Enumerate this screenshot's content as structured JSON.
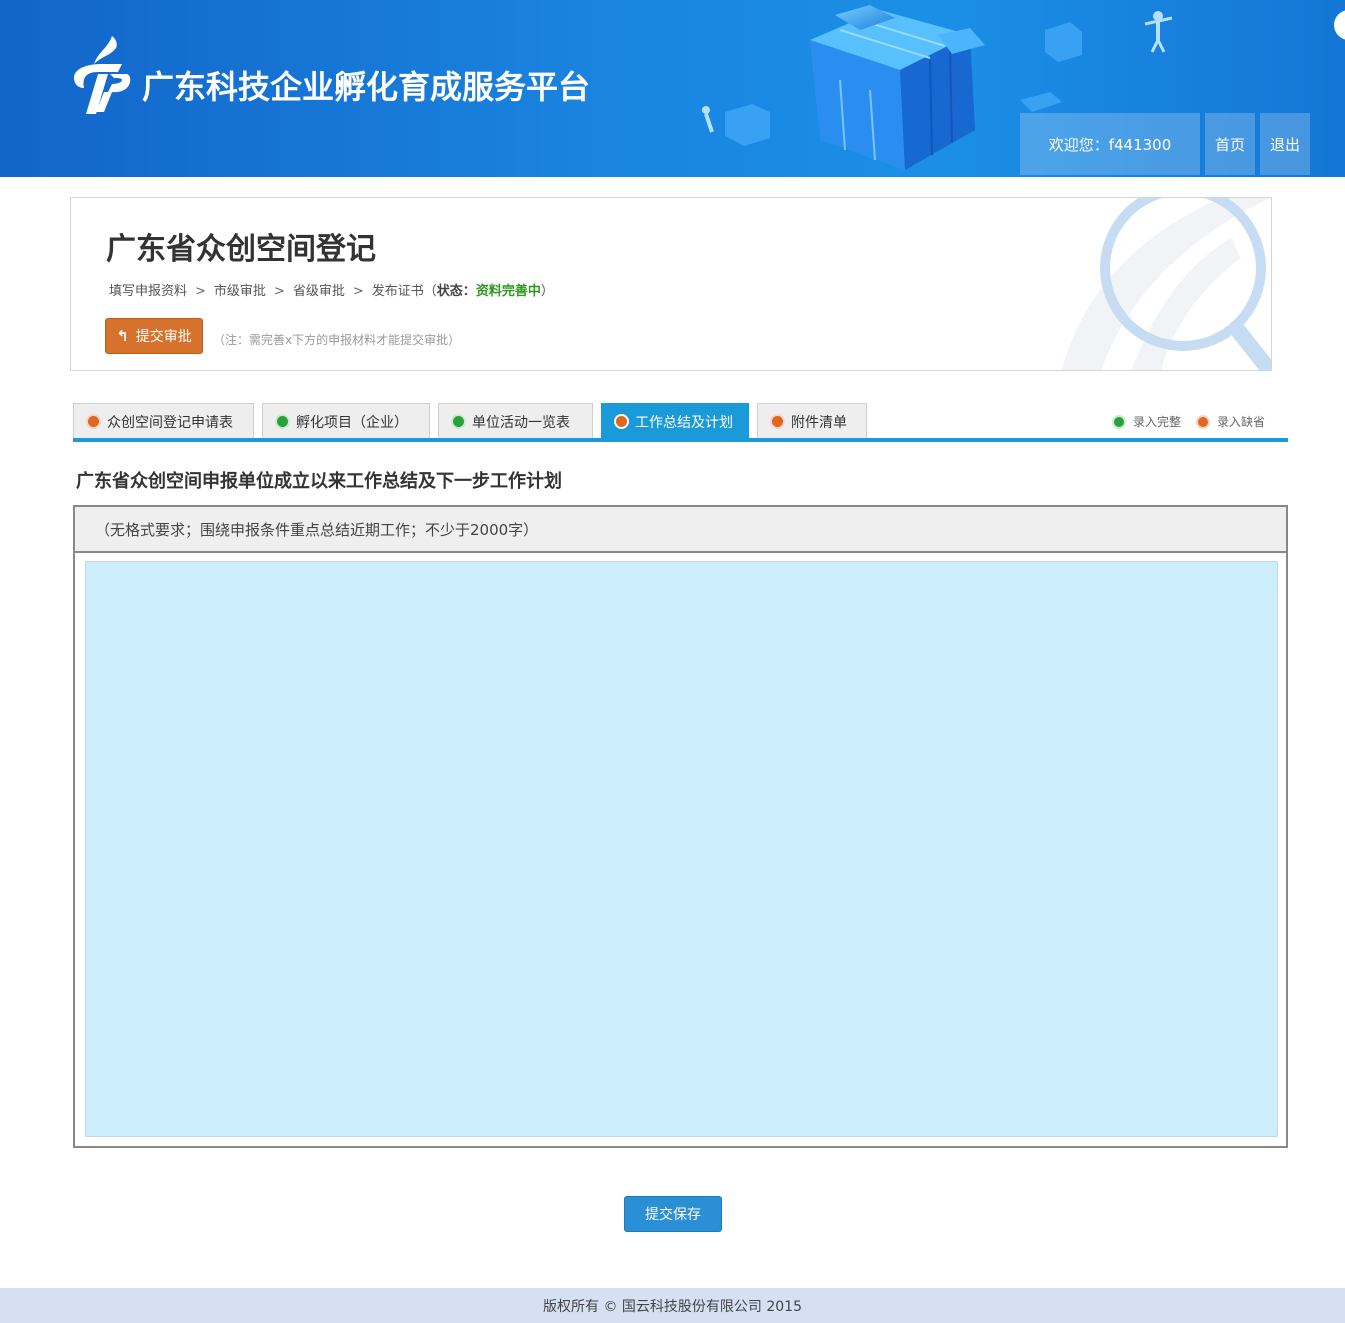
{
  "header": {
    "site_title": "广东科技企业孵化育成服务平台",
    "welcome": "欢迎您：f441300",
    "home_label": "首页",
    "logout_label": "退出",
    "colors": {
      "header_blue": "#1a84e0"
    }
  },
  "info": {
    "page_title": "广东省众创空间登记",
    "steps": [
      "填写申报资料",
      "市级审批",
      "省级审批",
      "发布证书"
    ],
    "step_separator": ">",
    "status_open": "（",
    "status_label": "状态：",
    "status_value": "资料完善中",
    "status_close": "）",
    "submit_label": "提交审批",
    "note": "（注：需完善x下方的申报材料才能提交审批）"
  },
  "tabs": [
    {
      "label": "众创空间登记申请表",
      "status": "orange",
      "active": false
    },
    {
      "label": "孵化项目（企业）",
      "status": "green",
      "active": false
    },
    {
      "label": "单位活动一览表",
      "status": "green",
      "active": false
    },
    {
      "label": "工作总结及计划",
      "status": "orange",
      "active": true
    },
    {
      "label": "附件清单",
      "status": "orange",
      "active": false
    }
  ],
  "legend": {
    "complete": "录入完整",
    "missing": "录入缺省",
    "colors": {
      "complete": "#2aa13a",
      "missing": "#e0671f"
    }
  },
  "section": {
    "title": "广东省众创空间申报单位成立以来工作总结及下一步工作计划",
    "hint": "（无格式要求；围绕申报条件重点总结近期工作；不少于2000字）",
    "textarea_value": ""
  },
  "save_label": "提交保存",
  "footer": "版权所有 © 国云科技股份有限公司 2015"
}
